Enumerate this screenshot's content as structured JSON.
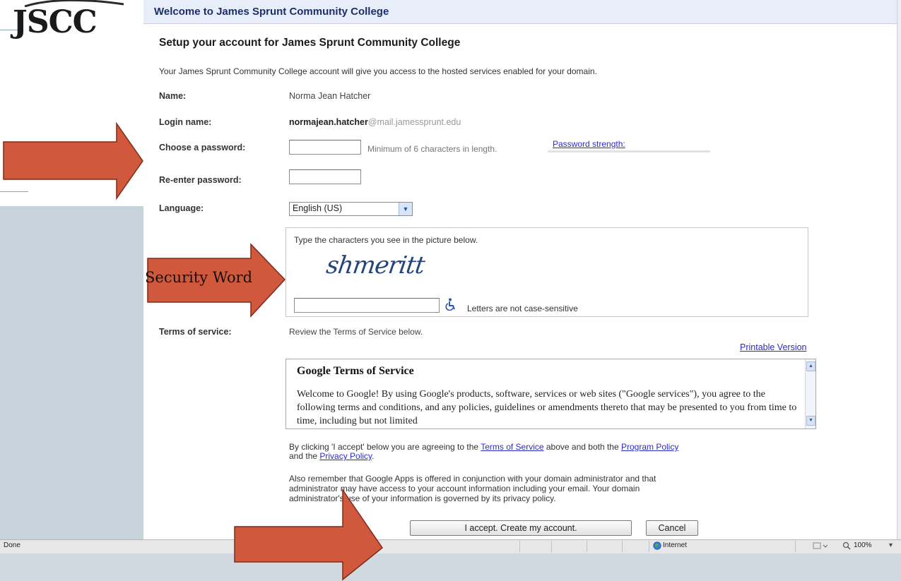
{
  "logo": {
    "text": "JSCC"
  },
  "header": {
    "title": "Welcome to James Sprunt Community College"
  },
  "page": {
    "heading": "Setup your account for James Sprunt Community College",
    "intro": "Your James Sprunt Community College account will give you access to the hosted services enabled for your domain."
  },
  "form": {
    "name_label": "Name:",
    "name_value": "Norma Jean Hatcher",
    "login_label": "Login name:",
    "login_user": "normajean.hatcher",
    "login_domain": "@mail.jamessprunt.edu",
    "password_label": "Choose a password:",
    "password_value": "",
    "password_hint": "Minimum of 6 characters in length.",
    "password_strength_link": "Password strength:",
    "reenter_label": "Re-enter password:",
    "reenter_value": "",
    "language_label": "Language:",
    "language_value": "English (US)"
  },
  "captcha": {
    "instruction": "Type the characters you see in the picture below.",
    "image_text": "shmeritt",
    "input_value": "",
    "case_note": "Letters are not case-sensitive",
    "accessibility_icon": "wheelchair-icon"
  },
  "tos": {
    "label": "Terms of service:",
    "review_text": "Review the Terms of Service below.",
    "printable_link": "Printable Version",
    "box_title": "Google Terms of Service",
    "box_text": "Welcome to Google! By using Google's products, software, services or web sites (\"Google services\"), you agree to the following terms and conditions, and any policies, guidelines or amendments thereto that may be presented to you from time to time, including but not limited",
    "agree_prefix": "By clicking 'I accept' below you are agreeing to the ",
    "terms_link": "Terms of Service",
    "agree_mid": " above and both the ",
    "program_link": "Program Policy",
    "agree_and": "and the ",
    "privacy_link": "Privacy Policy",
    "agree_end": ".",
    "remember_line1": "Also remember that Google Apps is offered in conjunction with your domain administrator and that",
    "remember_line2": "administrator may have access to your account information including your email. Your domain",
    "remember_line3": "administrator's use of your information is governed by its privacy policy."
  },
  "buttons": {
    "accept": "I accept. Create my account.",
    "cancel": "Cancel"
  },
  "statusbar": {
    "status": "Done",
    "zone": "Internet",
    "zoom": "100%"
  },
  "annotations": {
    "security_word": "Security Word",
    "arrow_color": "#d0593d"
  }
}
